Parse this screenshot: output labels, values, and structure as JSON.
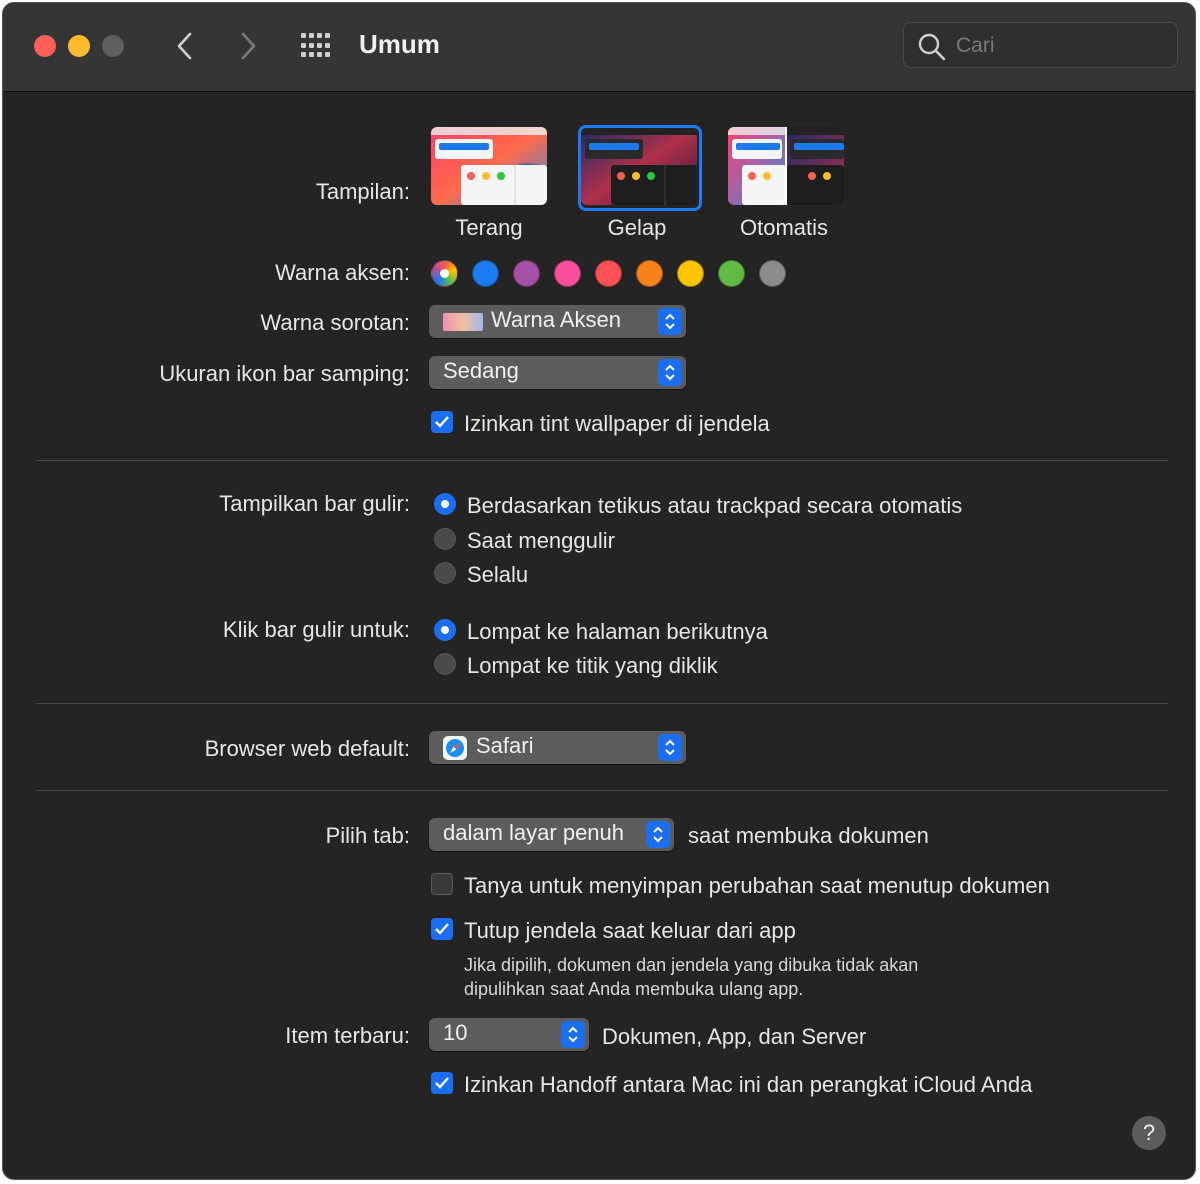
{
  "window": {
    "title": "Umum"
  },
  "search": {
    "placeholder": "Cari"
  },
  "appearance": {
    "label": "Tampilan:",
    "options": [
      "Terang",
      "Gelap",
      "Otomatis"
    ],
    "selected": "Gelap"
  },
  "accent": {
    "label": "Warna aksen:",
    "colors": [
      "multicolor",
      "#1c7bf0",
      "#a550a7",
      "#f74f9e",
      "#ff5257",
      "#f7821b",
      "#ffc600",
      "#62ba46",
      "#8c8c8c"
    ]
  },
  "highlight": {
    "label": "Warna sorotan:",
    "value": "Warna Aksen"
  },
  "sidebar_icon": {
    "label": "Ukuran ikon bar samping:",
    "value": "Sedang"
  },
  "tint": {
    "label": "Izinkan tint wallpaper di jendela",
    "checked": true
  },
  "scrollbars": {
    "label": "Tampilkan bar gulir:",
    "options": [
      "Berdasarkan tetikus atau trackpad secara otomatis",
      "Saat menggulir",
      "Selalu"
    ],
    "selected": 0
  },
  "click_scroll": {
    "label": "Klik bar gulir untuk:",
    "options": [
      "Lompat ke halaman berikutnya",
      "Lompat ke titik yang diklik"
    ],
    "selected": 0
  },
  "browser": {
    "label": "Browser web default:",
    "value": "Safari"
  },
  "tabs": {
    "label": "Pilih tab:",
    "value": "dalam layar penuh",
    "suffix": "saat membuka dokumen"
  },
  "ask_save": {
    "label": "Tanya untuk menyimpan perubahan saat menutup dokumen",
    "checked": false
  },
  "close_windows": {
    "label": "Tutup jendela saat keluar dari app",
    "checked": true,
    "note_line1": "Jika dipilih, dokumen dan jendela yang dibuka tidak akan",
    "note_line2": "dipulihkan saat Anda membuka ulang app."
  },
  "recent": {
    "label": "Item terbaru:",
    "value": "10",
    "suffix": "Dokumen, App, dan Server"
  },
  "handoff": {
    "label": "Izinkan Handoff antara Mac ini dan perangkat iCloud Anda",
    "checked": true
  },
  "help": {
    "label": "?"
  }
}
